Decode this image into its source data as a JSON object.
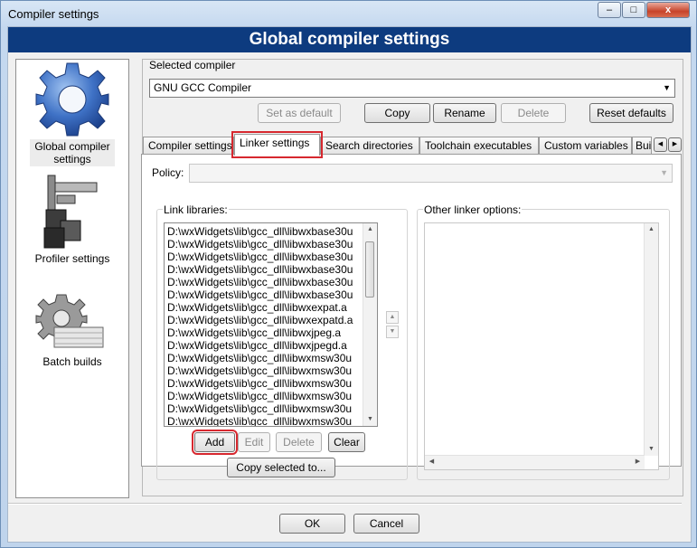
{
  "window": {
    "title": "Compiler settings",
    "minimize": "–",
    "maximize": "□",
    "close": "x"
  },
  "banner": "Global compiler settings",
  "sidebar": {
    "items": [
      {
        "label": "Global compiler settings",
        "icon": "gear-icon",
        "selected": true
      },
      {
        "label": "Profiler settings",
        "icon": "caliper-icon",
        "selected": false
      },
      {
        "label": "Batch builds",
        "icon": "batch-gear-icon",
        "selected": false
      }
    ]
  },
  "compiler": {
    "label": "Selected compiler",
    "value": "GNU GCC Compiler",
    "buttons": {
      "set_default": "Set as default",
      "copy": "Copy",
      "rename": "Rename",
      "delete": "Delete",
      "reset": "Reset defaults"
    }
  },
  "tabs": [
    "Compiler settings",
    "Linker settings",
    "Search directories",
    "Toolchain executables",
    "Custom variables",
    "Build"
  ],
  "active_tab": "Linker settings",
  "linker": {
    "policy_label": "Policy:",
    "policy_value": "",
    "link_libraries_label": "Link libraries:",
    "other_options_label": "Other linker options:",
    "libraries": [
      "D:\\wxWidgets\\lib\\gcc_dll\\libwxbase30u",
      "D:\\wxWidgets\\lib\\gcc_dll\\libwxbase30u",
      "D:\\wxWidgets\\lib\\gcc_dll\\libwxbase30u",
      "D:\\wxWidgets\\lib\\gcc_dll\\libwxbase30u",
      "D:\\wxWidgets\\lib\\gcc_dll\\libwxbase30u",
      "D:\\wxWidgets\\lib\\gcc_dll\\libwxbase30u",
      "D:\\wxWidgets\\lib\\gcc_dll\\libwxexpat.a",
      "D:\\wxWidgets\\lib\\gcc_dll\\libwxexpatd.a",
      "D:\\wxWidgets\\lib\\gcc_dll\\libwxjpeg.a",
      "D:\\wxWidgets\\lib\\gcc_dll\\libwxjpegd.a",
      "D:\\wxWidgets\\lib\\gcc_dll\\libwxmsw30u",
      "D:\\wxWidgets\\lib\\gcc_dll\\libwxmsw30u",
      "D:\\wxWidgets\\lib\\gcc_dll\\libwxmsw30u",
      "D:\\wxWidgets\\lib\\gcc_dll\\libwxmsw30u",
      "D:\\wxWidgets\\lib\\gcc_dll\\libwxmsw30u",
      "D:\\wxWidgets\\lib\\gcc_dll\\libwxmsw30u"
    ],
    "buttons": {
      "add": "Add",
      "edit": "Edit",
      "delete": "Delete",
      "clear": "Clear",
      "copy_to": "Copy selected to..."
    }
  },
  "footer": {
    "ok": "OK",
    "cancel": "Cancel"
  },
  "colors": {
    "banner": "#0d3b7f",
    "highlight": "#d7282f"
  }
}
